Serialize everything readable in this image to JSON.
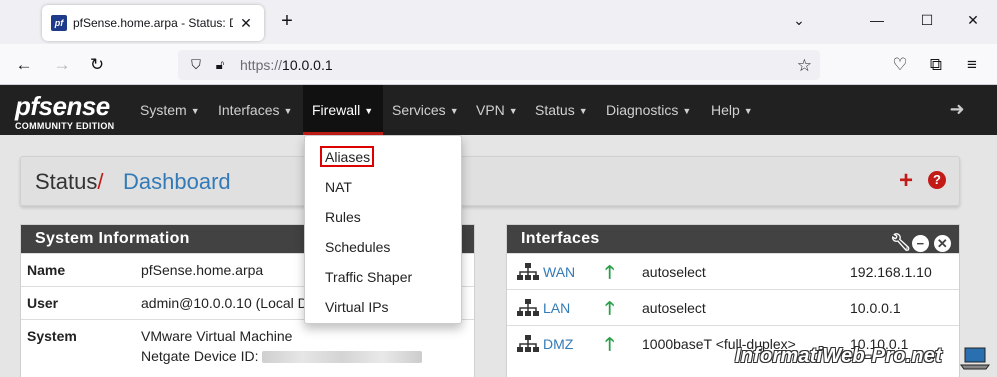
{
  "browser": {
    "tab_title": "pfSense.home.arpa - Status: Da",
    "tab_favicon_text": "pf",
    "url_protocol": "https://",
    "url_host": "10.0.0.1"
  },
  "pfsense": {
    "logo_main": "pfsense",
    "logo_sub": "COMMUNITY EDITION",
    "menu": [
      {
        "label": "System"
      },
      {
        "label": "Interfaces"
      },
      {
        "label": "Firewall"
      },
      {
        "label": "Services"
      },
      {
        "label": "VPN"
      },
      {
        "label": "Status"
      },
      {
        "label": "Diagnostics"
      },
      {
        "label": "Help"
      }
    ],
    "firewall_dropdown": [
      "Aliases",
      "NAT",
      "Rules",
      "Schedules",
      "Traffic Shaper",
      "Virtual IPs"
    ]
  },
  "breadcrumb": {
    "section": "Status",
    "separator": "/",
    "page": "Dashboard"
  },
  "system_info": {
    "title": "System Information",
    "rows": [
      {
        "label": "Name",
        "value": "pfSense.home.arpa"
      },
      {
        "label": "User",
        "value": "admin@10.0.0.10 (Local D"
      },
      {
        "label": "System",
        "value": "VMware Virtual Machine",
        "value2_label": "Netgate Device ID:"
      }
    ]
  },
  "interfaces": {
    "title": "Interfaces",
    "rows": [
      {
        "name": "WAN",
        "media": "autoselect",
        "ip": "192.168.1.10",
        "status": "up"
      },
      {
        "name": "LAN",
        "media": "autoselect",
        "ip": "10.0.0.1",
        "status": "up"
      },
      {
        "name": "DMZ",
        "media": "1000baseT <full-duplex>",
        "ip": "10.10.0.1",
        "status": "up"
      }
    ]
  },
  "watermark": "InformatiWeb-Pro.net",
  "colors": {
    "accent_red": "#c21b17",
    "link_blue": "#337ab7",
    "nav_dark": "#212121",
    "panel_head": "#424242",
    "status_up": "#27a046"
  }
}
